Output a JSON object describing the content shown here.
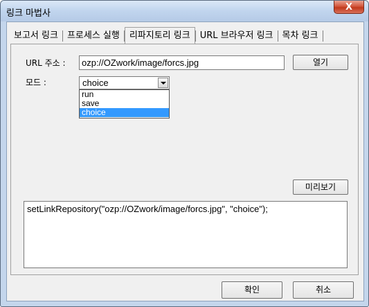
{
  "window": {
    "title": "링크 마법사",
    "close_label": "X"
  },
  "tabs": [
    {
      "label": "보고서 링크"
    },
    {
      "label": "프로세스 실행"
    },
    {
      "label": "리파지토리 링크"
    },
    {
      "label": "URL 브라우저 링크"
    },
    {
      "label": "목차 링크"
    }
  ],
  "active_tab": "리파지토리 링크",
  "form": {
    "url_label": "URL 주소 :",
    "url_value": "ozp://OZwork/image/forcs.jpg",
    "open_button": "열기",
    "mode_label": "모드 :",
    "mode_value": "choice",
    "mode_options": [
      "run",
      "save",
      "choice"
    ],
    "mode_highlighted": "choice"
  },
  "preview_button": "미리보기",
  "code": "setLinkRepository(\"ozp://OZwork/image/forcs.jpg\", \"choice\");",
  "footer": {
    "ok_button": "확인",
    "cancel_button": "취소"
  },
  "colors": {
    "selection": "#3399ff",
    "close_button": "#c1391c"
  }
}
